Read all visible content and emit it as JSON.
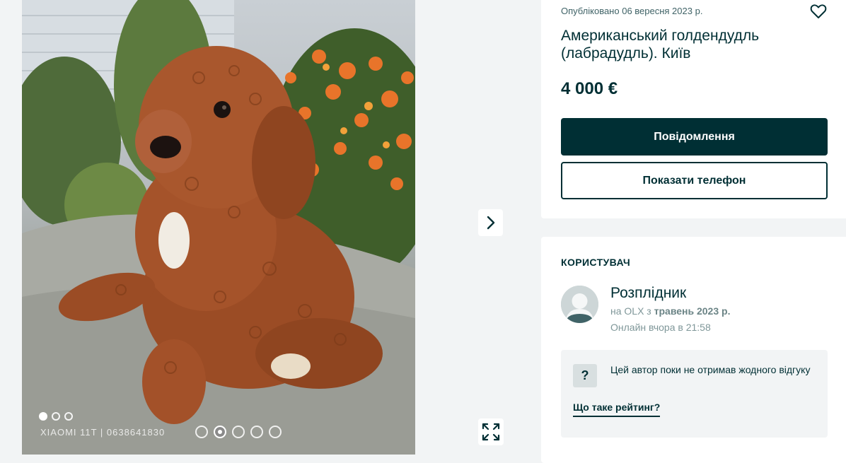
{
  "gallery": {
    "watermark": "XIAOMI 11T | 0638641830",
    "photo_alt": "Американський голдендудль (лабрадудль). Київ",
    "slide_count": 5,
    "active_slide": 1,
    "next_icon": "chevron-right-icon",
    "fullscreen_icon": "expand-icon"
  },
  "listing": {
    "published": "Опубліковано 06 вересня 2023 р.",
    "title": "Американський голдендудль (лабрадудль). Київ",
    "price": "4 000 €",
    "message_button": "Повідомлення",
    "phone_button": "Показати телефон",
    "favorite_icon": "heart-outline-icon"
  },
  "user": {
    "heading": "КОРИСТУВАЧ",
    "name": "Розплідник",
    "since_prefix": "на OLX з ",
    "since_date": "травень 2023 р.",
    "online": "Онлайн вчора в 21:58",
    "rating_icon": "?",
    "rating_text": "Цей автор поки не отримав жодного відгуку",
    "rating_link": "Що таке рейтинг?"
  },
  "colors": {
    "primary": "#002f34",
    "background": "#f2f4f5",
    "card": "#ffffff"
  }
}
